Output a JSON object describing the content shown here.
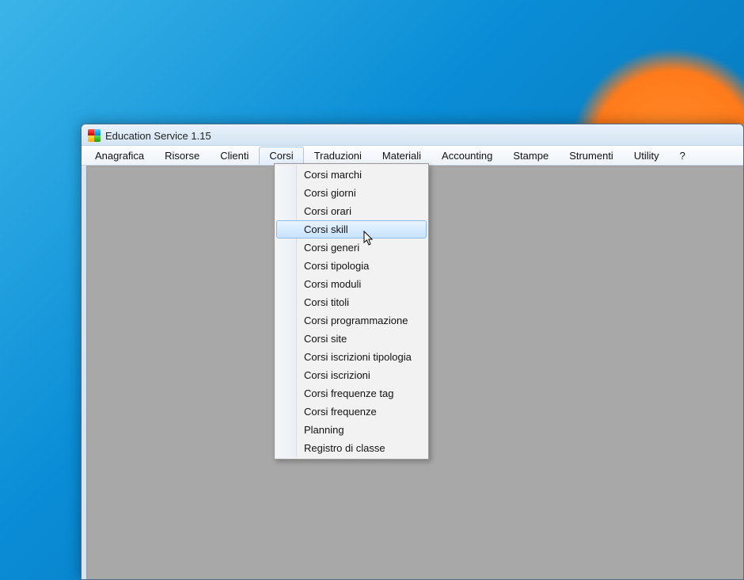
{
  "window": {
    "title": "Education Service 1.15"
  },
  "menu": {
    "items": [
      {
        "label": "Anagrafica"
      },
      {
        "label": "Risorse"
      },
      {
        "label": "Clienti"
      },
      {
        "label": "Corsi",
        "active": true
      },
      {
        "label": "Traduzioni"
      },
      {
        "label": "Materiali"
      },
      {
        "label": "Accounting"
      },
      {
        "label": "Stampe"
      },
      {
        "label": "Strumenti"
      },
      {
        "label": "Utility"
      },
      {
        "label": "?"
      }
    ]
  },
  "dropdown": {
    "items": [
      {
        "label": "Corsi marchi"
      },
      {
        "label": "Corsi giorni"
      },
      {
        "label": "Corsi orari"
      },
      {
        "label": "Corsi skill",
        "highlighted": true
      },
      {
        "label": "Corsi generi"
      },
      {
        "label": "Corsi tipologia"
      },
      {
        "label": "Corsi moduli"
      },
      {
        "label": "Corsi titoli"
      },
      {
        "label": "Corsi programmazione"
      },
      {
        "label": "Corsi site"
      },
      {
        "label": "Corsi iscrizioni tipologia"
      },
      {
        "label": "Corsi iscrizioni"
      },
      {
        "label": "Corsi frequenze tag"
      },
      {
        "label": "Corsi frequenze"
      },
      {
        "label": "Planning"
      },
      {
        "label": "Registro di classe"
      }
    ]
  }
}
